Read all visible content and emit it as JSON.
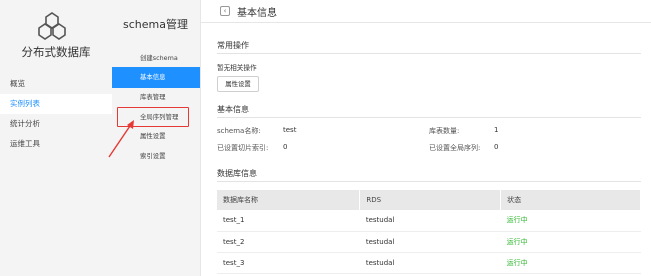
{
  "app": {
    "title": "分布式数据库"
  },
  "left_nav": {
    "items": [
      {
        "label": "概览",
        "active": false
      },
      {
        "label": "实例列表",
        "active": true
      },
      {
        "label": "统计分析",
        "active": false
      },
      {
        "label": "运维工具",
        "active": false
      }
    ]
  },
  "sub_nav": {
    "title": "schema管理",
    "items": [
      {
        "label": "创建schema",
        "active": false
      },
      {
        "label": "基本信息",
        "active": true
      },
      {
        "label": "库表管理",
        "active": false
      },
      {
        "label": "全局序列管理",
        "active": false,
        "highlighted": true
      },
      {
        "label": "属性设置",
        "active": false
      },
      {
        "label": "索引设置",
        "active": false
      }
    ]
  },
  "header": {
    "back_icon": "chevron-left-icon",
    "title": "基本信息"
  },
  "common_ops": {
    "title": "常用操作",
    "no_ops_text": "暂无相关操作",
    "button_label": "属性设置"
  },
  "basic_info": {
    "title": "基本信息",
    "schema_name_label": "schema名称:",
    "schema_name_value": "test",
    "table_count_label": "库表数量:",
    "table_count_value": "1",
    "shard_index_label": "已设置切片索引:",
    "shard_index_value": "0",
    "global_seq_label": "已设置全局序列:",
    "global_seq_value": "0"
  },
  "db_info": {
    "title": "数据库信息",
    "columns": [
      "数据库名称",
      "RDS",
      "状态"
    ],
    "rows": [
      {
        "name": "test_1",
        "rds": "testudal",
        "status": "运行中"
      },
      {
        "name": "test_2",
        "rds": "testudal",
        "status": "运行中"
      },
      {
        "name": "test_3",
        "rds": "testudal",
        "status": "运行中"
      }
    ]
  },
  "colors": {
    "accent": "#1e90ff",
    "status_running": "#2eb82e",
    "annotation": "#e53935"
  }
}
